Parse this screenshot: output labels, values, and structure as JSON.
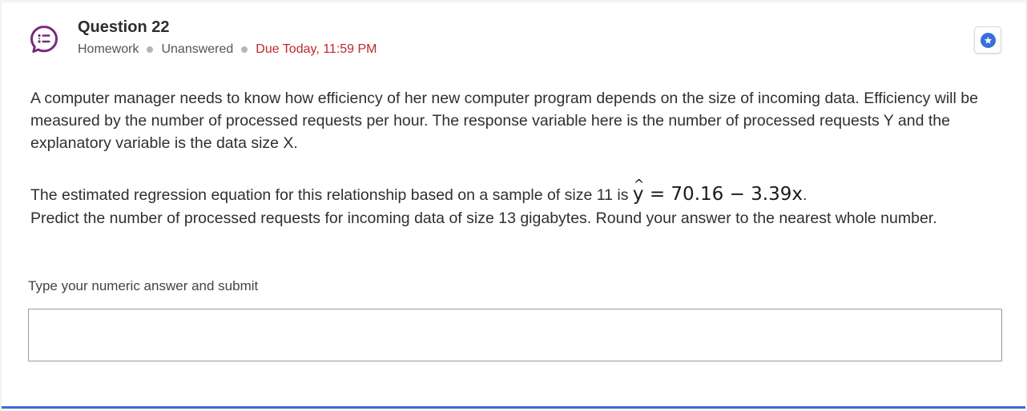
{
  "question": {
    "title": "Question 22",
    "meta": {
      "type": "Homework",
      "status": "Unanswered",
      "due": "Due Today, 11:59 PM"
    }
  },
  "body": {
    "paragraph1": "A computer manager needs to know how efficiency of her new computer program depends on the size of incoming data. Efficiency will be measured by the number of processed requests per hour. The response variable here is the number of processed requests Y and the explanatory variable is the data size X.",
    "paragraph2_prefix": "The estimated regression equation for this relationship based on a sample of size 11 is",
    "equation_lhs": "y",
    "equation_rhs": " = 70.16 − 3.39x",
    "equation_suffix": ".",
    "paragraph3": "Predict the number of processed requests for incoming data of size 13 gigabytes. Round your answer to the nearest whole number."
  },
  "answer": {
    "label": "Type your numeric answer and submit",
    "value": ""
  },
  "colors": {
    "accent": "#3a6fd8",
    "due": "#c0272d",
    "icon": "#7a2a7e",
    "bottom_border": "#3b6dd1"
  },
  "icons": {
    "question_icon": "chat-list-icon",
    "bookmark_icon": "star-icon"
  }
}
